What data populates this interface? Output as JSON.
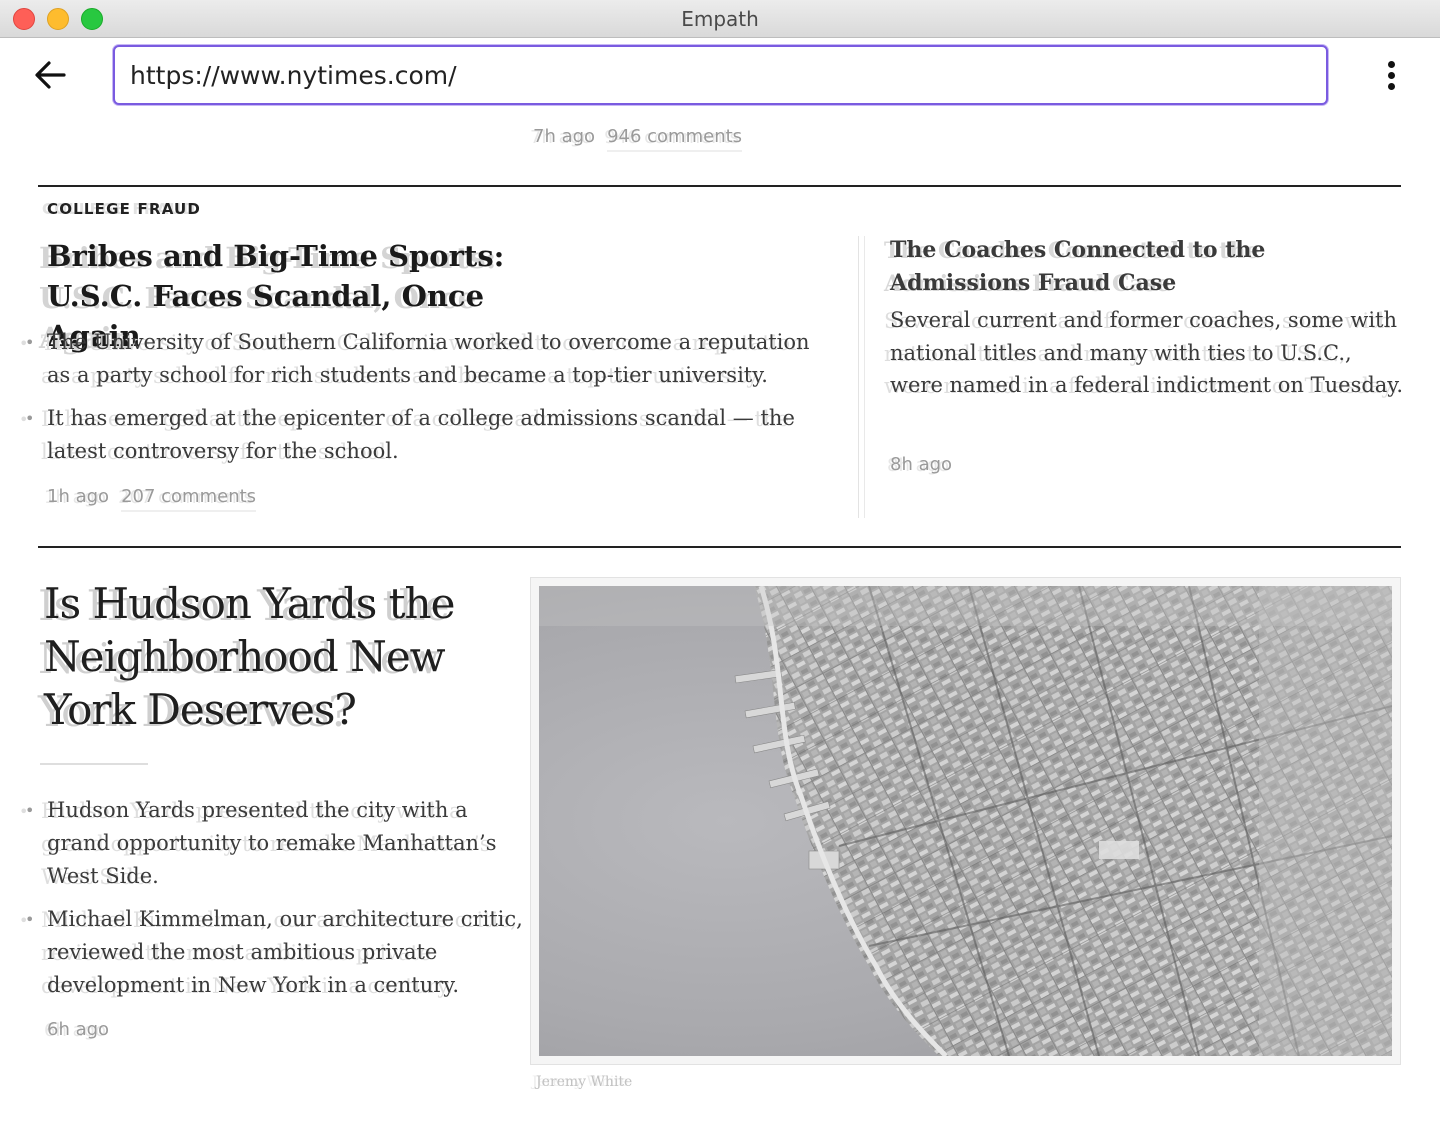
{
  "window": {
    "title": "Empath"
  },
  "toolbar": {
    "url": "https://www.nytimes.com/",
    "back_icon": "arrow-left-icon",
    "menu_icon": "vertical-dots-icon"
  },
  "top_story_meta": {
    "time": "7h ago",
    "comments": "946 comments"
  },
  "section_a": {
    "kicker": "COLLEGE FRAUD",
    "headline_line1": "Bribes and Big-Time Sports:",
    "headline_line2": "U.S.C. Faces Scandal, Once Again",
    "bullets": [
      "The University of Southern California worked to overcome a reputation as a party school for rich students and became a top-tier university.",
      "It has emerged at the epicenter of a college admissions scandal — the latest controversy for the school."
    ],
    "time": "1h ago",
    "comments": "207 comments"
  },
  "section_b": {
    "headline": "The Coaches Connected to the Admissions Fraud Case",
    "summary": "Several current and former coaches, some with national titles and many with ties to U.S.C., were named in a federal indictment on Tuesday.",
    "time": "8h ago"
  },
  "section_c": {
    "headline_line1": "Is Hudson Yards the",
    "headline_line2": "Neighborhood New",
    "headline_line3": "York Deserves?",
    "bullets": [
      "Hudson Yards presented the city with a grand opportunity to remake Manhattan’s West Side.",
      "Michael Kimmelman, our architecture critic, reviewed the most ambitious private development in New York in a century."
    ],
    "time": "6h ago",
    "photo_credit": "Jeremy White"
  },
  "colors": {
    "url_focus_border": "#7a5be0",
    "close": "#fe5f57",
    "minimize": "#febc2e",
    "maximize": "#28c840"
  }
}
